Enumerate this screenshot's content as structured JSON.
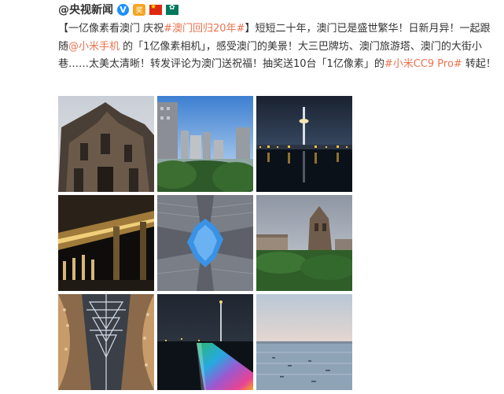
{
  "header": {
    "username": "@央视新闻",
    "verified_badge": "V",
    "gold_badge": "奖",
    "icons": [
      "verified-v-icon",
      "gold-badge-icon",
      "china-flag-icon",
      "macau-flag-icon"
    ]
  },
  "post": {
    "seg1": "【一亿像素看澳门 庆祝",
    "tag1": "#澳门回归20年#",
    "seg2": "】短短二十年，澳门已是盛世繁华！日新月异！一起跟随",
    "mention": "@小米手机",
    "seg3": " 的「1亿像素相机」，感受澳门的美景！大三巴牌坊、澳门旅游塔、澳门的大街小巷……太美太清晰！转发评论为澳门送祝福！抽奖送10台「1亿像素」的",
    "tag2": "#小米CC9 Pro#",
    "seg4": " 转起！"
  },
  "colors": {
    "link": "#eb7350",
    "text": "#333333",
    "verified": "#1e90ff"
  },
  "photos": [
    {
      "name": "ruins-st-paul-facade"
    },
    {
      "name": "city-skyline-greenery"
    },
    {
      "name": "macau-tower-night"
    },
    {
      "name": "bridge-night-lights"
    },
    {
      "name": "buildings-looking-up-sky"
    },
    {
      "name": "ruins-st-paul-park"
    },
    {
      "name": "architecture-pattern-interior"
    },
    {
      "name": "rainbow-light-walkway"
    },
    {
      "name": "sea-dusk-skyline"
    }
  ]
}
